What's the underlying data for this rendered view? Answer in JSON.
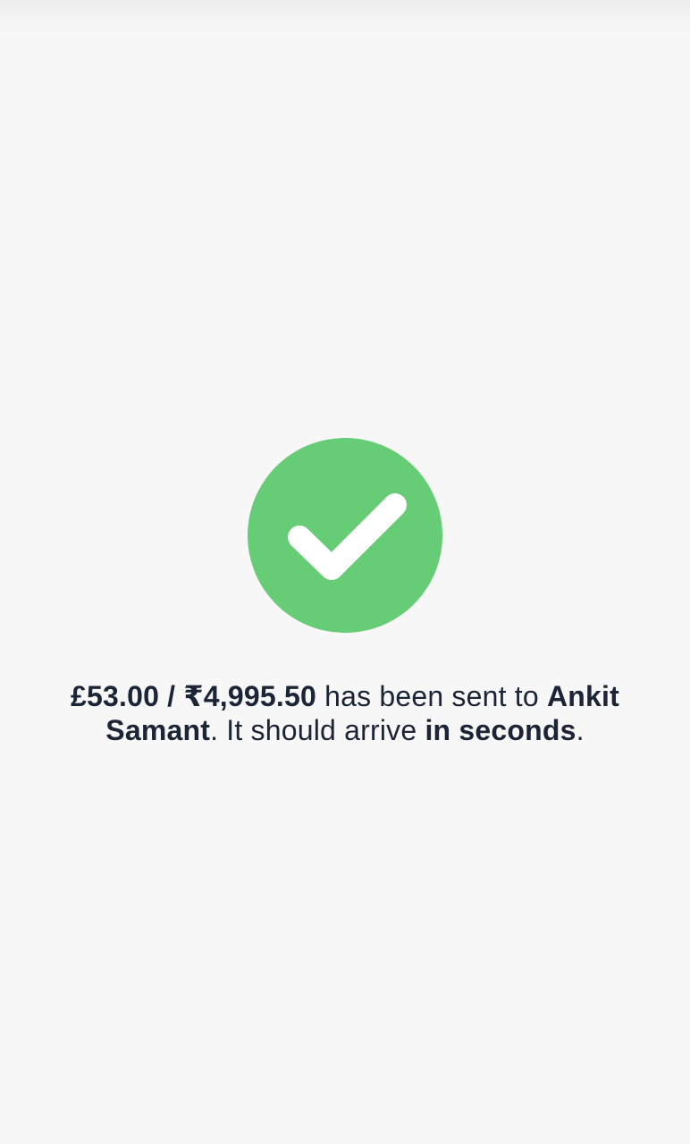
{
  "status": {
    "icon": "check-circle-icon",
    "color": "#66cc75"
  },
  "message": {
    "amount": "£53.00 / ₹4,995.50",
    "text_sent": " has been sent to ",
    "recipient": "Ankit Samant",
    "text_arrive": ". It should arrive ",
    "timing": "in seconds",
    "text_end": "."
  }
}
